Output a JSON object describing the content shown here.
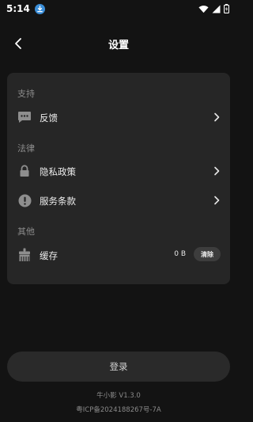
{
  "statusbar": {
    "time": "5:14",
    "icons": [
      "download-icon",
      "wifi-icon",
      "signal-icon",
      "battery-charging-icon"
    ]
  },
  "header": {
    "back_icon": "chevron-left-icon",
    "title": "设置"
  },
  "sections": {
    "support": {
      "label": "支持",
      "items": [
        {
          "label": "反馈",
          "icon": "message-dots-icon"
        }
      ]
    },
    "legal": {
      "label": "法律",
      "items": [
        {
          "label": "隐私政策",
          "icon": "lock-icon"
        },
        {
          "label": "服务条款",
          "icon": "alert-circle-icon"
        }
      ]
    },
    "other": {
      "label": "其他",
      "items": [
        {
          "label": "缓存",
          "icon": "broom-icon",
          "value": "0 B",
          "action_label": "清除"
        }
      ]
    }
  },
  "login": {
    "label": "登录"
  },
  "footer": {
    "version": "牛小影 V1.3.0",
    "icp": "粤ICP备2024188267号-7A"
  },
  "colors": {
    "background": "#131313",
    "card": "#262626",
    "accent_badge": "#3b8ed8"
  }
}
